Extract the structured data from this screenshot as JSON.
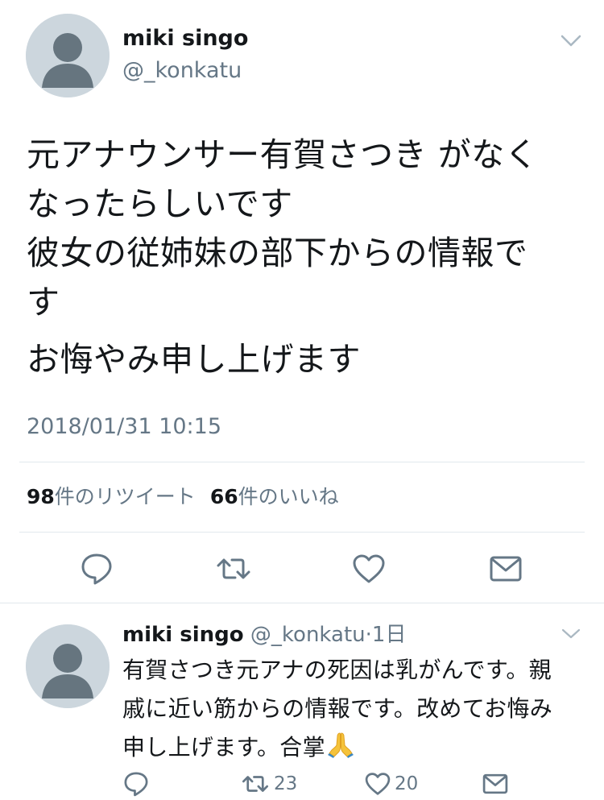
{
  "main_tweet": {
    "author_name": "miki singo",
    "author_handle": "@_konkatu",
    "text_lines": [
      "元アナウンサー有賀さつき がなく",
      "なったらしいです",
      "彼女の従姉妹の部下からの情報で",
      "す"
    ],
    "text_paragraph2": "お悔やみ申し上げます",
    "timestamp": "2018/01/31 10:15",
    "retweet_count": "98",
    "retweet_label": "件のリツイート",
    "like_count": "66",
    "like_label": "件のいいね",
    "actions": [
      "reply-icon",
      "retweet-icon",
      "heart-icon",
      "envelope-icon"
    ]
  },
  "reply_tweet": {
    "author_name": "miki singo",
    "author_handle": "@_konkatu",
    "separator": "·",
    "relative_time": "1日",
    "text_lines": [
      "有賀さつき元アナの死因は乳がんです。親",
      "戚に近い筋からの情報です。改めてお悔み",
      "申し上げます。合掌"
    ],
    "emoji": "folded-hands-icon",
    "retweet_count": "23",
    "like_count": "20"
  },
  "colors": {
    "text": "#14171a",
    "secondary": "#657786",
    "divider": "#e1e8ed",
    "avatar_bg": "#ccd6dd",
    "avatar_fg": "#66757f",
    "icon": "#657786"
  }
}
